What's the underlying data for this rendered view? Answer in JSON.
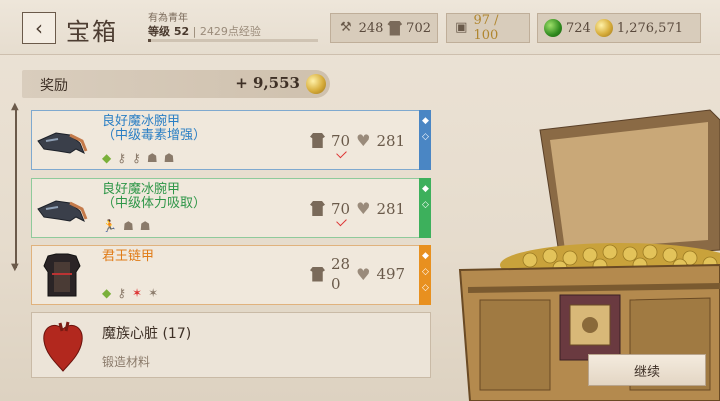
{
  "header": {
    "back_icon": "‹",
    "title": "宝箱",
    "player_name": "有為青年",
    "level_label": "等级 52",
    "xp_text": "2429点经验",
    "xp_progress": 0.02,
    "stats": {
      "weapon": "248",
      "armor": "702",
      "capacity": "97 / 100",
      "gems": "724",
      "gold": "1,276,571"
    }
  },
  "reward": {
    "label": "奖励",
    "value": "+ 9,553"
  },
  "items": [
    {
      "name_line1": "良好魔冰腕甲",
      "name_line2": "（中级毒素增强）",
      "armor": "70",
      "hp": "281",
      "rarity_color": "#4a86c4",
      "icons": [
        "gem-icon",
        "key-icon",
        "key-icon",
        "skull-icon",
        "skull-icon"
      ]
    },
    {
      "name_line1": "良好魔冰腕甲",
      "name_line2": "（中级体力吸取）",
      "armor": "70",
      "hp": "281",
      "rarity_color": "#3db05c",
      "icons": [
        "runner-icon",
        "skull-icon",
        "skull-icon"
      ]
    },
    {
      "name_line1": "君王链甲",
      "name_line2": "",
      "armor_top": "28",
      "armor_bottom": "0",
      "hp": "497",
      "rarity_color": "#e8901f",
      "icons": [
        "gem-icon",
        "key-icon",
        "star-icon",
        "star-icon"
      ]
    }
  ],
  "material": {
    "name": "魔族心脏 (17)",
    "sub": "锻造材料"
  },
  "continue_label": "继续"
}
